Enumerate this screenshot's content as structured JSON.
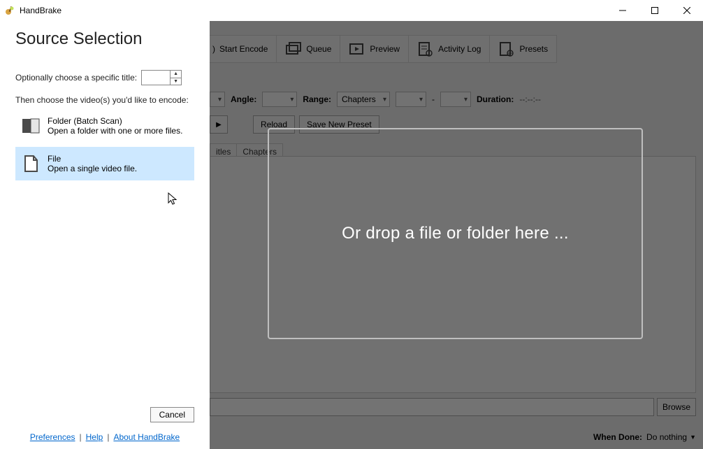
{
  "window": {
    "title": "HandBrake"
  },
  "toolbar": {
    "start_encode": "Start Encode",
    "queue": "Queue",
    "preview": "Preview",
    "activity_log": "Activity Log",
    "presets": "Presets"
  },
  "controls": {
    "angle_label": "Angle:",
    "range_label": "Range:",
    "range_value": "Chapters",
    "dash": "-",
    "duration_label": "Duration:",
    "duration_value": "--:--:--",
    "reload": "Reload",
    "save_new_preset": "Save New Preset"
  },
  "tabs": {
    "titles": "itles",
    "chapters": "Chapters"
  },
  "browse": {
    "button": "Browse"
  },
  "footer": {
    "when_done_label": "When Done:",
    "when_done_value": "Do nothing"
  },
  "drop": {
    "text": "Or drop a file or folder here ..."
  },
  "panel": {
    "title": "Source Selection",
    "opt_title_label": "Optionally choose a specific title:",
    "then_label": "Then choose the video(s) you'd like to encode:",
    "folder": {
      "title": "Folder (Batch Scan)",
      "desc": "Open a folder with one or more files."
    },
    "file": {
      "title": "File",
      "desc": "Open a single video file."
    },
    "cancel": "Cancel",
    "links": {
      "preferences": "Preferences",
      "help": "Help",
      "about": "About HandBrake"
    }
  }
}
